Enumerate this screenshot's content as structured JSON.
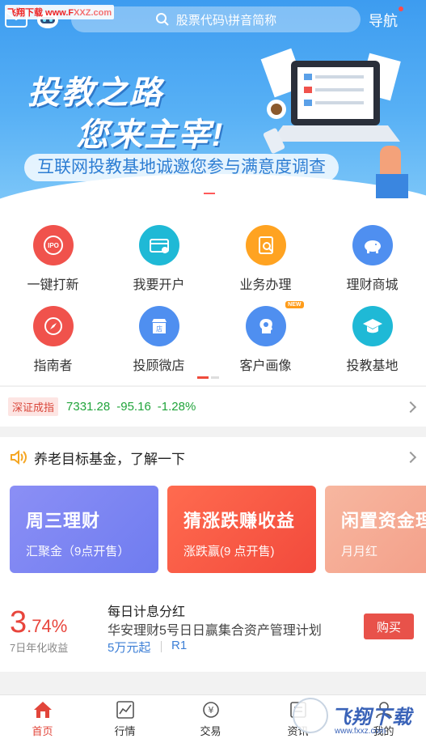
{
  "watermark": "飞翔下载 www.FXXZ.com",
  "header": {
    "search_placeholder": "股票代码\\拼音简称",
    "nav_label": "导航"
  },
  "banner": {
    "slogan_line1": "投教之路",
    "slogan_line2": "您来主宰!",
    "invite_text": "互联网投教基地诚邀您参与满意度调查"
  },
  "menu": {
    "items": [
      {
        "label": "一键打新",
        "color": "#f0524c",
        "icon": "ipo-icon"
      },
      {
        "label": "我要开户",
        "color": "#1fb9d6",
        "icon": "account-card-icon"
      },
      {
        "label": "业务办理",
        "color": "#ffa321",
        "icon": "business-icon"
      },
      {
        "label": "理财商城",
        "color": "#4f8ff0",
        "icon": "piggy-bank-icon"
      },
      {
        "label": "指南者",
        "color": "#f0524c",
        "icon": "compass-icon"
      },
      {
        "label": "投顾微店",
        "color": "#4f8ff0",
        "icon": "shop-icon"
      },
      {
        "label": "客户画像",
        "color": "#4f8ff0",
        "icon": "profile-head-icon",
        "badge": "NEW"
      },
      {
        "label": "投教基地",
        "color": "#1fb9d6",
        "icon": "graduation-cap-icon"
      }
    ]
  },
  "index": {
    "name": "深证成指",
    "value": "7331.28",
    "change": "-95.16",
    "percent": "-1.28%"
  },
  "notice": {
    "text": "养老目标基金，了解一下"
  },
  "cards": [
    {
      "title": "周三理财",
      "sub": "汇聚金（9点开售）"
    },
    {
      "title": "猜涨跌赚收益",
      "sub": "涨跌赢(9 点开售)"
    },
    {
      "title": "闲置资金理",
      "sub": "月月红"
    }
  ],
  "product": {
    "yield_int": "3",
    "yield_dec": ".74%",
    "yield_label": "7日年化收益",
    "tag": "每日计息分红",
    "name": "华安理财5号日日赢集合资产管理计划",
    "min_amount": "5万元起",
    "risk": "R1",
    "buy_label": "购买"
  },
  "tabs": [
    {
      "label": "首页",
      "icon": "home-icon",
      "active": true
    },
    {
      "label": "行情",
      "icon": "chart-icon",
      "active": false
    },
    {
      "label": "交易",
      "icon": "yuan-exchange-icon",
      "active": false
    },
    {
      "label": "资讯",
      "icon": "news-icon",
      "active": false
    },
    {
      "label": "我的",
      "icon": "user-icon",
      "active": false
    }
  ],
  "logo_watermark": {
    "text": "飞翔下载",
    "url": "www.fxxz.com"
  }
}
